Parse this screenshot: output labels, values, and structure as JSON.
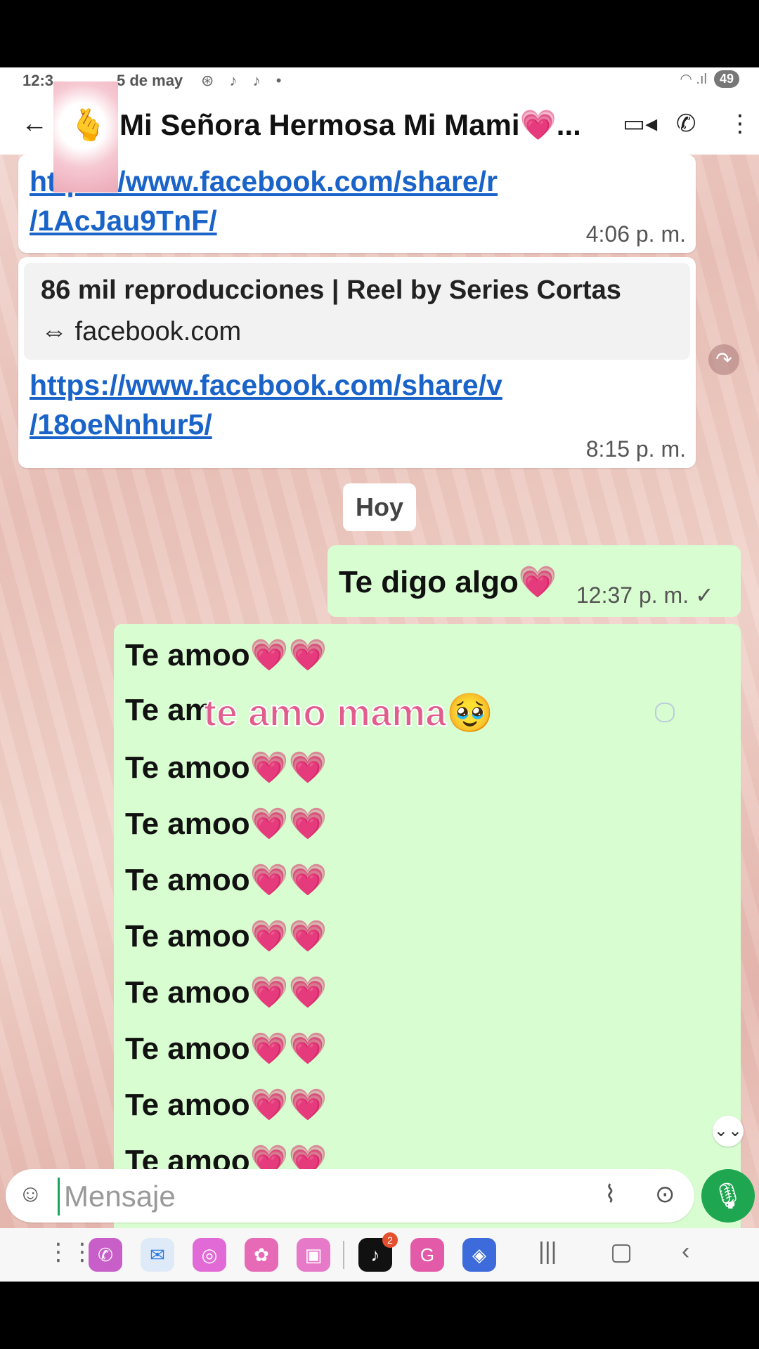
{
  "status": {
    "time": "12:3",
    "date": "5 de may",
    "icons": "⊛ ♪ ♪ •",
    "battery": "49"
  },
  "header": {
    "title": "Mi Señora Hermosa Mi Mami💗...",
    "back": "←",
    "avatar": "🫰",
    "video": "▭◂",
    "call": "✆",
    "menu": "⋮"
  },
  "messages": {
    "link1": {
      "line1": "https://www.facebook.com/share/r",
      "line2": "/1AcJau9TnF/",
      "time": "4:06 p. m."
    },
    "preview": {
      "title": "86 mil reproducciones | Reel by Series Cortas",
      "domain": "⇔ facebook.com"
    },
    "link2": {
      "line1": "https://www.facebook.com/share/v",
      "line2": "/18oeNnhur5/",
      "time": "8:15 p. m."
    },
    "forward": "↷",
    "day": "Hoy",
    "out1": {
      "text": "Te digo algo💗",
      "time": "12:37 p. m. ✓"
    },
    "amoo": [
      "Te amoo💗💗",
      "Te am",
      "Te amoo💗💗",
      "Te amoo💗💗",
      "Te amoo💗💗",
      "Te amoo💗💗",
      "Te amoo💗💗",
      "Te amoo💗💗",
      "Te amoo💗💗",
      "Te amoo💗💗"
    ],
    "overlay": "te amo mama🥹",
    "scroll_down": "⌄⌄"
  },
  "input": {
    "placeholder": "Mensaje",
    "emoji": "☺",
    "clip": "⌇",
    "camera": "⊙",
    "mic": "🎙"
  },
  "navbar": {
    "apps": "⋮⋮⋮",
    "recent": "|||",
    "home": "▢",
    "back": "‹",
    "badge": "2"
  },
  "colors": {
    "out_bubble": "#d8fdd0",
    "link": "#1a63c8",
    "mic": "#1ea650"
  }
}
